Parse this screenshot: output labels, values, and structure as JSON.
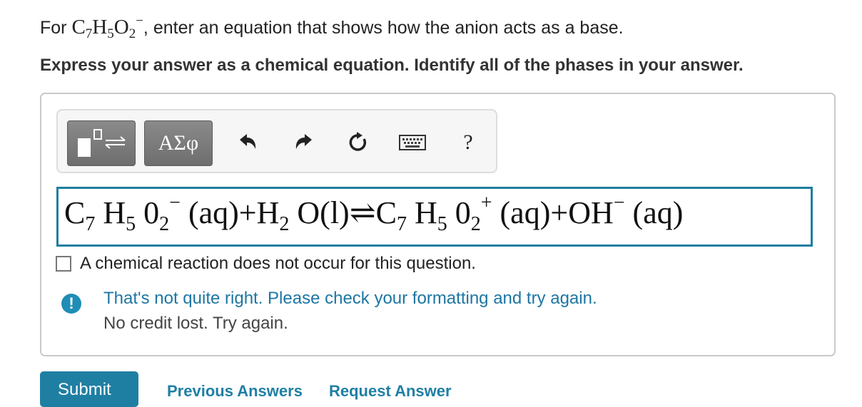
{
  "prompt": {
    "lead": "For ",
    "formula": {
      "c": "C",
      "c_sub": "7",
      "h": "H",
      "h_sub": "5",
      "o": "O",
      "o_sub": "2",
      "charge": "−"
    },
    "tail": ", enter an equation that shows how the anion acts as a base."
  },
  "instruction": "Express your answer as a chemical equation. Identify all of the phases in your answer.",
  "toolbar": {
    "symbols_label": "ΑΣφ",
    "help_label": "?",
    "icons": [
      "templates-icon",
      "undo-icon",
      "redo-icon",
      "reset-icon",
      "keyboard-icon",
      "help-icon"
    ]
  },
  "equation": {
    "parts": [
      "C",
      "7",
      "H",
      "5",
      "0",
      "2",
      "−",
      "(aq)",
      "+",
      "H",
      "2",
      "O(l)",
      "⇌",
      "C",
      "7",
      "H",
      "5",
      "0",
      "2",
      "+",
      "(aq)",
      "+",
      "OH",
      "−",
      "(aq)"
    ]
  },
  "no_reaction": {
    "label": "A chemical reaction does not occur for this question.",
    "checked": false
  },
  "feedback": {
    "icon_glyph": "!",
    "message": "That's not quite right. Please check your formatting and try again.",
    "note": "No credit lost. Try again."
  },
  "actions": {
    "submit": "Submit",
    "previous_answers": "Previous Answers",
    "request_answer": "Request Answer"
  },
  "colors": {
    "accent": "#1f7fa3",
    "field_border": "#1e7ea0",
    "feedback_text": "#1d76a3"
  }
}
